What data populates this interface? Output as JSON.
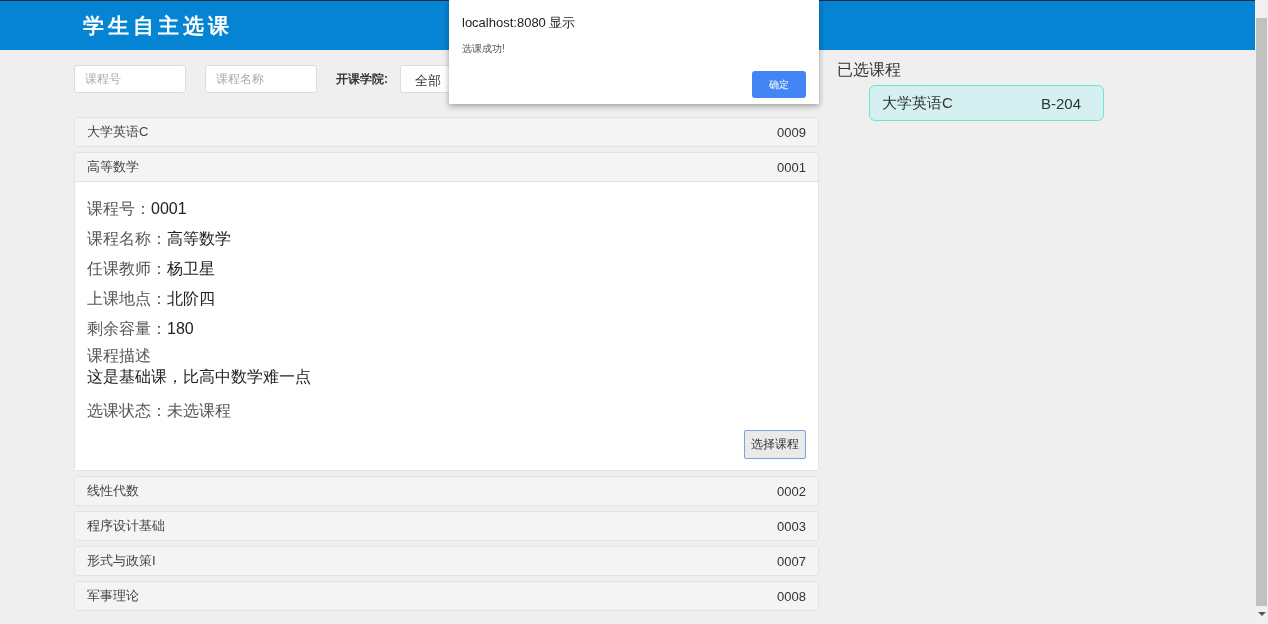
{
  "header": {
    "title": "学生自主选课"
  },
  "filters": {
    "course_no": {
      "placeholder": "课程号"
    },
    "course_name": {
      "placeholder": "课程名称"
    },
    "college": {
      "label": "开课学院:",
      "value": "全部"
    }
  },
  "courses": [
    {
      "name": "大学英语C",
      "code": "0009",
      "expanded": false
    },
    {
      "name": "高等数学",
      "code": "0001",
      "expanded": true,
      "details": [
        {
          "label": "课程号：",
          "value": "0001"
        },
        {
          "label": "课程名称：",
          "value": "高等数学"
        },
        {
          "label": "任课教师：",
          "value": "杨卫星"
        },
        {
          "label": "上课地点：",
          "value": "北阶四"
        },
        {
          "label": "剩余容量：",
          "value": "180"
        }
      ],
      "description_label": "课程描述",
      "description": "这是基础课，比高中数学难一点",
      "status": {
        "label": "选课状态：",
        "value": "未选课程"
      },
      "button": "选择课程"
    },
    {
      "name": "线性代数",
      "code": "0002",
      "expanded": false
    },
    {
      "name": "程序设计基础",
      "code": "0003",
      "expanded": false
    },
    {
      "name": "形式与政策I",
      "code": "0007",
      "expanded": false
    },
    {
      "name": "军事理论",
      "code": "0008",
      "expanded": false
    }
  ],
  "selected_panel": {
    "title": "已选课程",
    "items": [
      {
        "name": "大学英语C",
        "room": "B-204"
      }
    ]
  },
  "dialog": {
    "title": "localhost:8080 显示",
    "message": "选课成功!",
    "button": "确定"
  }
}
